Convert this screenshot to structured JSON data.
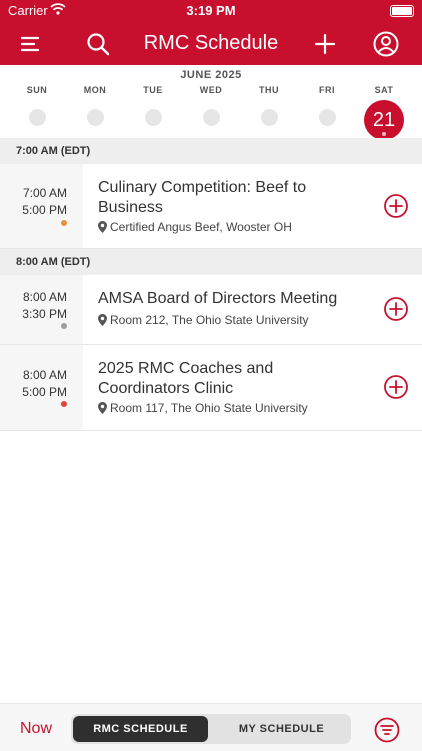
{
  "status_bar": {
    "carrier": "Carrier",
    "time": "3:19 PM"
  },
  "nav": {
    "title": "RMC Schedule"
  },
  "calendar": {
    "month": "JUNE 2025",
    "days": [
      "SUN",
      "MON",
      "TUE",
      "WED",
      "THU",
      "FRI",
      "SAT"
    ],
    "selected_date": "21"
  },
  "sections": [
    {
      "header": "7:00 AM (EDT)",
      "events": [
        {
          "start": "7:00 AM",
          "end": "5:00 PM",
          "title": "Culinary Competition: Beef to Business",
          "location": "Certified Angus Beef, Wooster OH",
          "dot_color": "#e8913a"
        }
      ]
    },
    {
      "header": "8:00 AM (EDT)",
      "events": [
        {
          "start": "8:00 AM",
          "end": "3:30 PM",
          "title": "AMSA Board of Directors Meeting",
          "location": "Room 212, The Ohio State University",
          "dot_color": "#9e9e9e"
        },
        {
          "start": "8:00 AM",
          "end": "5:00 PM",
          "title": "2025 RMC Coaches and Coordinators Clinic",
          "location": "Room 117, The Ohio State University",
          "dot_color": "#e0443a"
        }
      ]
    }
  ],
  "bottom_bar": {
    "now_label": "Now",
    "tab_rmc": "RMC SCHEDULE",
    "tab_my": "MY SCHEDULE"
  },
  "colors": {
    "accent": "#c8102e"
  }
}
